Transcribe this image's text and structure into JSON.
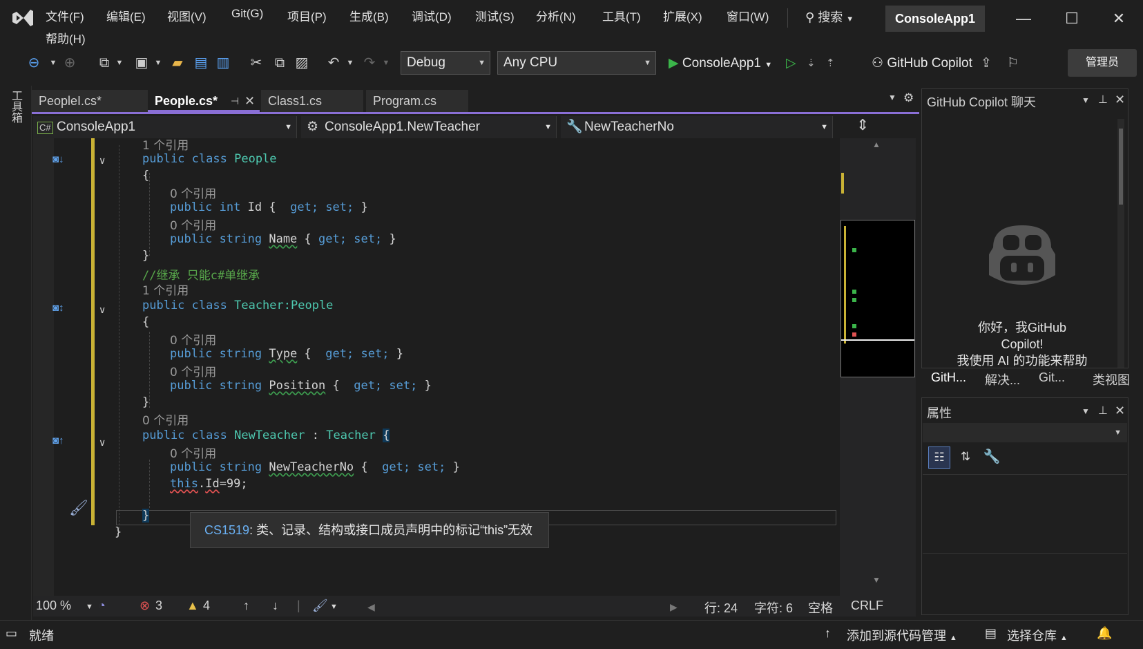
{
  "menu": {
    "items": [
      "文件(F)",
      "编辑(E)",
      "视图(V)",
      "Git(G)",
      "项目(P)",
      "生成(B)",
      "调试(D)",
      "测试(S)",
      "分析(N)",
      "工具(T)",
      "扩展(X)",
      "窗口(W)"
    ],
    "help": "帮助(H)",
    "search": "搜索",
    "solution_name": "ConsoleApp1"
  },
  "toolbar": {
    "config": "Debug",
    "platform": "Any CPU",
    "run_target": "ConsoleApp1",
    "copilot": "GitHub Copilot",
    "admin": "管理员"
  },
  "toolbox_label": "工具箱",
  "tabs": [
    "PeopleI.cs*",
    "People.cs*",
    "Class1.cs",
    "Program.cs"
  ],
  "nav": {
    "project": "ConsoleApp1",
    "class": "ConsoleApp1.NewTeacher",
    "member": "NewTeacherNo"
  },
  "code": {
    "ref1": "1 个引用",
    "ref0": "0 个引用",
    "line_class_people": [
      "public",
      "class",
      "People"
    ],
    "brace_open": "{",
    "brace_close": "}",
    "line_id": [
      "public",
      "int",
      "Id",
      "{",
      "get;",
      "set;",
      "}"
    ],
    "line_name": [
      "public",
      "string",
      "Name",
      "{",
      "get;",
      "set;",
      "}"
    ],
    "comment": "//继承 只能c#单继承",
    "line_class_teacher": [
      "public",
      "class",
      "Teacher",
      ":People"
    ],
    "line_type": [
      "public",
      "string",
      "Type",
      "{",
      "get;",
      "set;",
      "}"
    ],
    "line_position": [
      "public",
      "string",
      "Position",
      "{",
      "get;",
      "set;",
      "}"
    ],
    "line_class_newteacher": [
      "public",
      "class",
      "NewTeacher",
      ":",
      "Teacher",
      "{"
    ],
    "line_newteacherno": [
      "public",
      "string",
      "NewTeacherNo",
      "{",
      "get;",
      "set;",
      "}"
    ],
    "line_this": [
      "this",
      ".",
      "Id",
      "=99;"
    ]
  },
  "tooltip": {
    "code": "CS1519",
    "message": ": 类、记录、结构或接口成员声明中的标记“this”无效"
  },
  "editor_status": {
    "zoom": "100 %",
    "errors": "3",
    "warnings": "4",
    "line": "行: 24",
    "char": "字符: 6",
    "spacing": "空格",
    "eol": "CRLF"
  },
  "copilot_panel": {
    "title": "GitHub Copilot 聊天",
    "greeting_line1": "你好，我GitHub",
    "greeting_line2": "Copilot!",
    "greeting_line3": "我使用 AI 的功能来帮助",
    "tabs": [
      "GitH...",
      "解决...",
      "Git...",
      "类视图"
    ]
  },
  "properties_panel": {
    "title": "属性"
  },
  "statusbar": {
    "ready": "就绪",
    "source_control": "添加到源代码管理",
    "repo": "选择仓库"
  },
  "colors": {
    "accent": "#8a6fd6",
    "keyword": "#569cd6",
    "type": "#4ec9b0",
    "comment": "#57a64a",
    "error": "#e05252",
    "run": "#3bb54a"
  }
}
